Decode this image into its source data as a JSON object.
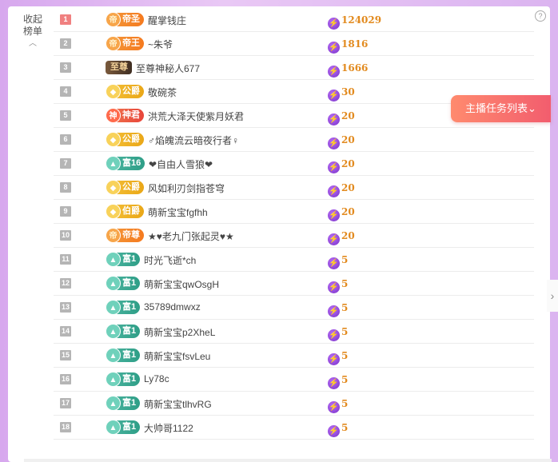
{
  "collapse": {
    "label_top": "收起",
    "label_bottom": "榜单",
    "chev": "︿"
  },
  "help": {
    "icon": "?"
  },
  "task_button": {
    "label": "主播任务列表",
    "chev": "⌄"
  },
  "side_arrow": "›",
  "rows": [
    {
      "rank": "1",
      "badge": "帝圣",
      "badge_style": "orange",
      "gem": "帝",
      "name": "醒掌钱庄",
      "score": "124029"
    },
    {
      "rank": "2",
      "badge": "帝王",
      "badge_style": "orange",
      "gem": "帝",
      "name": "~朱爷",
      "score": "1816"
    },
    {
      "rank": "3",
      "badge": "至尊",
      "badge_style": "dark",
      "gem": "",
      "name": "至尊神秘人677",
      "score": "1666"
    },
    {
      "rank": "4",
      "badge": "公爵",
      "badge_style": "gold",
      "gem": "◆",
      "name": "敬碗茶",
      "score": "30"
    },
    {
      "rank": "5",
      "badge": "神君",
      "badge_style": "red",
      "gem": "神",
      "name": "洪荒大泽天使紫月妖君",
      "score": "20"
    },
    {
      "rank": "6",
      "badge": "公爵",
      "badge_style": "gold",
      "gem": "◆",
      "name": "♂焰魄流云暗夜行者♀",
      "score": "20"
    },
    {
      "rank": "7",
      "badge": "富16",
      "badge_style": "teal",
      "gem": "▲",
      "name": "❤自由人雪狼❤",
      "score": "20"
    },
    {
      "rank": "8",
      "badge": "公爵",
      "badge_style": "gold",
      "gem": "◆",
      "name": "风如利刃剑指苍穹",
      "score": "20"
    },
    {
      "rank": "9",
      "badge": "伯爵",
      "badge_style": "gold",
      "gem": "◆",
      "name": "萌新宝宝fgfhh",
      "score": "20"
    },
    {
      "rank": "10",
      "badge": "帝尊",
      "badge_style": "orange",
      "gem": "帝",
      "name": "★♥老九门张起灵♥★",
      "score": "20"
    },
    {
      "rank": "11",
      "badge": "富1",
      "badge_style": "teal",
      "gem": "▲",
      "name": "时光飞逝*ch",
      "score": "5"
    },
    {
      "rank": "12",
      "badge": "富1",
      "badge_style": "teal",
      "gem": "▲",
      "name": "萌新宝宝qwOsgH",
      "score": "5"
    },
    {
      "rank": "13",
      "badge": "富1",
      "badge_style": "teal",
      "gem": "▲",
      "name": "35789dmwxz",
      "score": "5"
    },
    {
      "rank": "14",
      "badge": "富1",
      "badge_style": "teal",
      "gem": "▲",
      "name": "萌新宝宝p2XheL",
      "score": "5"
    },
    {
      "rank": "15",
      "badge": "富1",
      "badge_style": "teal",
      "gem": "▲",
      "name": "萌新宝宝fsvLeu",
      "score": "5"
    },
    {
      "rank": "16",
      "badge": "富1",
      "badge_style": "teal",
      "gem": "▲",
      "name": "Ly78c",
      "score": "5"
    },
    {
      "rank": "17",
      "badge": "富1",
      "badge_style": "teal",
      "gem": "▲",
      "name": "萌新宝宝tlhvRG",
      "score": "5"
    },
    {
      "rank": "18",
      "badge": "富1",
      "badge_style": "teal",
      "gem": "▲",
      "name": "大帅哥1122",
      "score": "5"
    }
  ]
}
